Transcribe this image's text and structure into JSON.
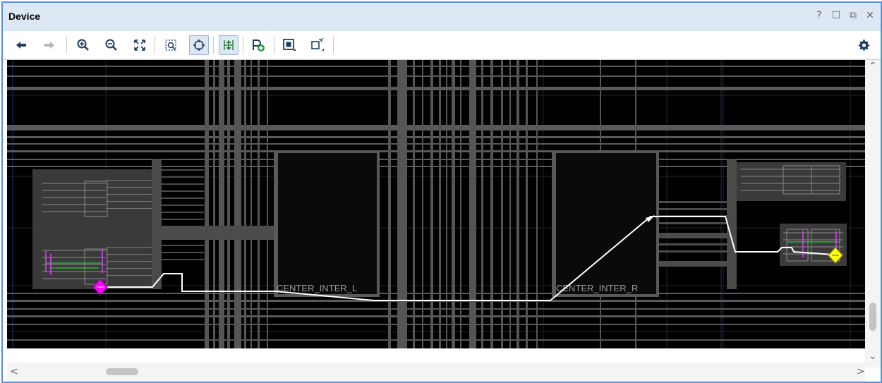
{
  "window": {
    "title": "Device"
  },
  "title_controls": [
    {
      "name": "help-icon",
      "glyph": "?"
    },
    {
      "name": "restore-icon",
      "glyph": "☐"
    },
    {
      "name": "float-icon",
      "glyph": "⧉"
    },
    {
      "name": "close-icon",
      "glyph": "✕"
    }
  ],
  "toolbar": {
    "buttons": [
      {
        "name": "back-icon"
      },
      {
        "name": "forward-icon"
      },
      {
        "name": "zoom-in-icon"
      },
      {
        "name": "zoom-out-icon"
      },
      {
        "name": "zoom-fit-icon"
      },
      {
        "name": "zoom-selection-icon"
      },
      {
        "name": "autofit-selection-icon",
        "active": true
      },
      {
        "name": "routing-resources-icon",
        "active": true
      },
      {
        "name": "add-pblock-icon"
      },
      {
        "name": "device-view-options-icon"
      },
      {
        "name": "select-area-icon"
      }
    ],
    "settings": {
      "name": "gear-icon"
    }
  },
  "device_view": {
    "cells": [
      {
        "label": "CENTER_INTER_L"
      },
      {
        "label": "CENTER_INTER_R"
      }
    ],
    "markers": [
      {
        "name": "source-pin-marker",
        "color": "#ff00ff"
      },
      {
        "name": "dest-pin-marker",
        "color": "#ffff00"
      }
    ],
    "colors": {
      "background": "#000000",
      "routing": "#595959",
      "net": "#ffffff",
      "wires_green": "#2fc43a",
      "wires_magenta": "#e040ff"
    }
  },
  "scrollbars": {
    "vertical": {
      "up": "⌃",
      "down": "⌄"
    },
    "horizontal": {
      "left": "<",
      "right": ">"
    }
  }
}
